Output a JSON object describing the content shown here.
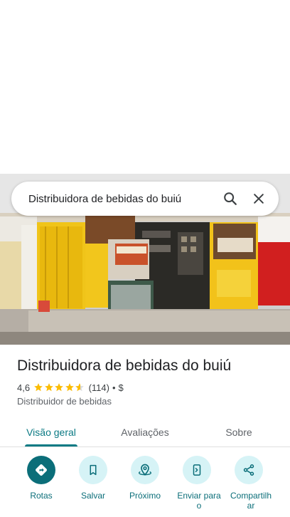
{
  "search": {
    "query": "Distribuidora de bebidas do buiú",
    "search_icon": "search-icon",
    "close_icon": "close-icon"
  },
  "place": {
    "name": "Distribuidora de bebidas do buiú",
    "rating": "4,6",
    "rating_value": 4.6,
    "reviews": "(114)",
    "separator": "•",
    "price": "$",
    "category": "Distribuidor de bebidas"
  },
  "tabs": [
    {
      "label": "Visão geral",
      "active": true
    },
    {
      "label": "Avaliações",
      "active": false
    },
    {
      "label": "Sobre",
      "active": false
    }
  ],
  "actions": [
    {
      "label": "Rotas",
      "icon": "directions-icon"
    },
    {
      "label": "Salvar",
      "icon": "bookmark-icon"
    },
    {
      "label": "Próximo",
      "icon": "nearby-icon"
    },
    {
      "label": "Enviar para o",
      "icon": "send-to-phone-icon"
    },
    {
      "label": "Compartilhar",
      "icon": "share-icon"
    }
  ],
  "colors": {
    "accent": "#0b7a84",
    "star": "#fbbc04",
    "action_bg": "#d6f3f6"
  }
}
